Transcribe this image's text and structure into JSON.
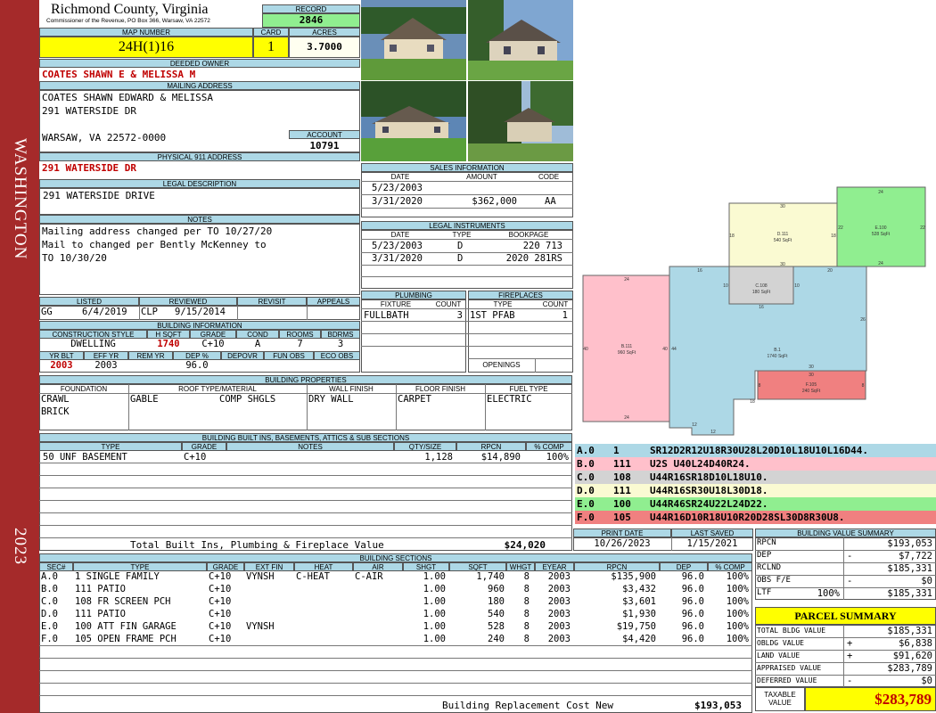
{
  "sidebar": {
    "district": "WASHINGTON",
    "year": "2023"
  },
  "header": {
    "county": "Richmond County, Virginia",
    "subtitle": "Commissioner of the Revenue, PO Box 366, Warsaw, VA 22572"
  },
  "record": {
    "label": "RECORD",
    "value": "2846"
  },
  "map": {
    "label": "MAP NUMBER",
    "value": "24H(1)16",
    "card_label": "CARD",
    "card": "1",
    "acres_label": "ACRES",
    "acres": "3.7000"
  },
  "owner": {
    "label": "DEEDED OWNER",
    "value": "COATES SHAWN E & MELISSA M"
  },
  "mailing": {
    "label": "MAILING ADDRESS",
    "line1": "COATES SHAWN EDWARD & MELISSA",
    "line2": "291 WATERSIDE DR",
    "line3": "WARSAW, VA 22572-0000"
  },
  "account": {
    "label": "ACCOUNT",
    "value": "10791"
  },
  "physical": {
    "label": "PHYSICAL 911 ADDRESS",
    "value": "291 WATERSIDE DR"
  },
  "legal": {
    "label": "LEGAL DESCRIPTION",
    "value": "291 WATERSIDE DRIVE"
  },
  "notes": {
    "label": "NOTES",
    "lines": [
      "Mailing address changed per TO 10/27/20",
      "Mail to changed per Bently McKenney to",
      "TO 10/30/20"
    ]
  },
  "sales": {
    "label": "SALES INFORMATION",
    "cols": [
      "DATE",
      "AMOUNT",
      "CODE"
    ],
    "rows": [
      [
        "5/23/2003",
        "",
        ""
      ],
      [
        "3/31/2020",
        "$362,000",
        "AA"
      ]
    ]
  },
  "instruments": {
    "label": "LEGAL INSTRUMENTS",
    "cols": [
      "DATE",
      "TYPE",
      "BOOKPAGE"
    ],
    "rows": [
      [
        "5/23/2003",
        "D",
        "220 713"
      ],
      [
        "3/31/2020",
        "D",
        "2020 281RS"
      ]
    ]
  },
  "review": {
    "cols": [
      "LISTED",
      "REVIEWED",
      "REVISIT",
      "APPEALS"
    ],
    "listed_by": "GG",
    "listed_date": "6/4/2019",
    "reviewed_by": "CLP",
    "reviewed_date": "9/15/2014"
  },
  "plumbing": {
    "label": "PLUMBING",
    "cols": [
      "FIXTURE",
      "COUNT"
    ],
    "fixture": "FULLBATH",
    "count": "3"
  },
  "fireplaces": {
    "label": "FIREPLACES",
    "cols": [
      "TYPE",
      "COUNT"
    ],
    "type": "1ST PFAB",
    "count": "1",
    "openings_label": "OPENINGS"
  },
  "building": {
    "label": "BUILDING INFORMATION",
    "cols": [
      "CONSTRUCTION STYLE",
      "H SQFT",
      "GRADE",
      "COND",
      "ROOMS",
      "BDRMS"
    ],
    "style": "DWELLING",
    "hsqft": "1740",
    "grade": "C+10",
    "cond": "A",
    "rooms": "7",
    "bdrms": "3",
    "cols2": [
      "YR BLT",
      "EFF YR",
      "REM YR",
      "DEP %",
      "DEPOVR",
      "FUN OBS",
      "ECO OBS"
    ],
    "yrblt": "2003",
    "effyr": "2003",
    "dep": "96.0"
  },
  "properties": {
    "label": "BUILDING PROPERTIES",
    "cols": [
      "FOUNDATION",
      "ROOF TYPE/MATERIAL",
      "WALL FINISH",
      "FLOOR FINISH",
      "FUEL TYPE"
    ],
    "foundation1": "CRAWL",
    "foundation2": "BRICK",
    "roof_type": "GABLE",
    "roof_material": "COMP SHGLS",
    "wall": "DRY WALL",
    "floor": "CARPET",
    "fuel": "ELECTRIC"
  },
  "builtins": {
    "label": "BUILDING BUILT INS, BASEMENTS, ATTICS & SUB SECTIONS",
    "cols": [
      "TYPE",
      "GRADE",
      "NOTES",
      "QTY/SIZE",
      "RPCN",
      "% COMP"
    ],
    "rows": [
      [
        "50 UNF BASEMENT",
        "C+10",
        "",
        "1,128",
        "$14,890",
        "100%"
      ]
    ],
    "total_label": "Total Built Ins, Plumbing & Fireplace Value",
    "total": "$24,020"
  },
  "print": {
    "cols": [
      "PRINT DATE",
      "LAST SAVED"
    ],
    "print_date": "10/26/2023",
    "last_saved": "1/15/2021"
  },
  "sections": {
    "label": "BUILDING SECTIONS",
    "cols": [
      "SEC#",
      "TYPE",
      "GRADE",
      "EXT FIN",
      "HEAT",
      "AIR",
      "SHGT",
      "SQFT",
      "WHGT",
      "EYEAR",
      "RPCN",
      "DEP",
      "% COMP"
    ],
    "rows": [
      [
        "A.0",
        "1 SINGLE FAMILY",
        "C+10",
        "VYNSH",
        "C-HEAT",
        "C-AIR",
        "1.00",
        "1,740",
        "8",
        "2003",
        "$135,900",
        "96.0",
        "100%"
      ],
      [
        "B.0",
        "111 PATIO",
        "C+10",
        "",
        "",
        "",
        "1.00",
        "960",
        "8",
        "2003",
        "$3,432",
        "96.0",
        "100%"
      ],
      [
        "C.0",
        "108 FR SCREEN PCH",
        "C+10",
        "",
        "",
        "",
        "1.00",
        "180",
        "8",
        "2003",
        "$3,601",
        "96.0",
        "100%"
      ],
      [
        "D.0",
        "111 PATIO",
        "C+10",
        "",
        "",
        "",
        "1.00",
        "540",
        "8",
        "2003",
        "$1,930",
        "96.0",
        "100%"
      ],
      [
        "E.0",
        "100 ATT FIN GARAGE",
        "C+10",
        "VYNSH",
        "",
        "",
        "1.00",
        "528",
        "8",
        "2003",
        "$19,750",
        "96.0",
        "100%"
      ],
      [
        "F.0",
        "105 OPEN FRAME PCH",
        "C+10",
        "",
        "",
        "",
        "1.00",
        "240",
        "8",
        "2003",
        "$4,420",
        "96.0",
        "100%"
      ]
    ],
    "total_label": "Building Replacement Cost New",
    "total": "$193,053"
  },
  "sketch": {
    "labels": {
      "a_name": "B.1",
      "a_area": "1740 SqFt",
      "b_name": "B.111",
      "b_area": "960 SqFt",
      "c_name": "C.108",
      "c_area": "180 SqFt",
      "d_name": "D.111",
      "d_area": "540 SqFt",
      "e_name": "E.100",
      "e_area": "528 SqFt",
      "f_name": "F.105",
      "f_area": "240 SqFt"
    },
    "dims": [
      "24",
      "22",
      "22",
      "24",
      "30",
      "18",
      "18",
      "30",
      "20",
      "10",
      "10",
      "16",
      "16",
      "26",
      "40",
      "40",
      "44",
      "24",
      "18",
      "30",
      "30",
      "8",
      "8",
      "12",
      "12",
      "12"
    ],
    "legend": [
      {
        "code": "A.0",
        "num": "1",
        "desc": "SR12D2R12U18R30U28L20D10L18U10L16D44.",
        "color": "#add8e6"
      },
      {
        "code": "B.0",
        "num": "111",
        "desc": "U2S U40L24D40R24.",
        "color": "#ffc0cb"
      },
      {
        "code": "C.0",
        "num": "108",
        "desc": "U44R16SR18D10L18U10.",
        "color": "#d3d3d3"
      },
      {
        "code": "D.0",
        "num": "111",
        "desc": "U44R16SR30U18L30D18.",
        "color": "#fafad2"
      },
      {
        "code": "E.0",
        "num": "100",
        "desc": "U44R46SR24U22L24D22.",
        "color": "#90ee90"
      },
      {
        "code": "F.0",
        "num": "105",
        "desc": "U44R16D10R18U10R20D28SL30D8R30U8.",
        "color": "#f08080"
      }
    ]
  },
  "summary": {
    "label": "BUILDING VALUE SUMMARY",
    "rpcn_label": "RPCN",
    "rpcn": "$193,053",
    "dep_label": "DEP",
    "dep_sign": "-",
    "dep": "$7,722",
    "rclnd_label": "RCLND",
    "rclnd": "$185,331",
    "obs_label": "OBS F/E",
    "obs_sign": "-",
    "obs": "$0",
    "ltf_label": "LTF",
    "ltf_pct": "100%",
    "ltf": "$185,331"
  },
  "parcel": {
    "label": "PARCEL SUMMARY",
    "total_bldg_label": "TOTAL BLDG VALUE",
    "total_bldg": "$185,331",
    "obldg_label": "OBLDG VALUE",
    "obldg_sign": "+",
    "obldg": "$6,838",
    "land_label": "LAND VALUE",
    "land_sign": "+",
    "land": "$91,620",
    "appraised_label": "APPRAISED VALUE",
    "appraised": "$283,789",
    "deferred_label": "DEFERRED VALUE",
    "deferred_sign": "-",
    "deferred": "$0",
    "taxable_label1": "TAXABLE",
    "taxable_label2": "VALUE",
    "taxable": "$283,789"
  }
}
